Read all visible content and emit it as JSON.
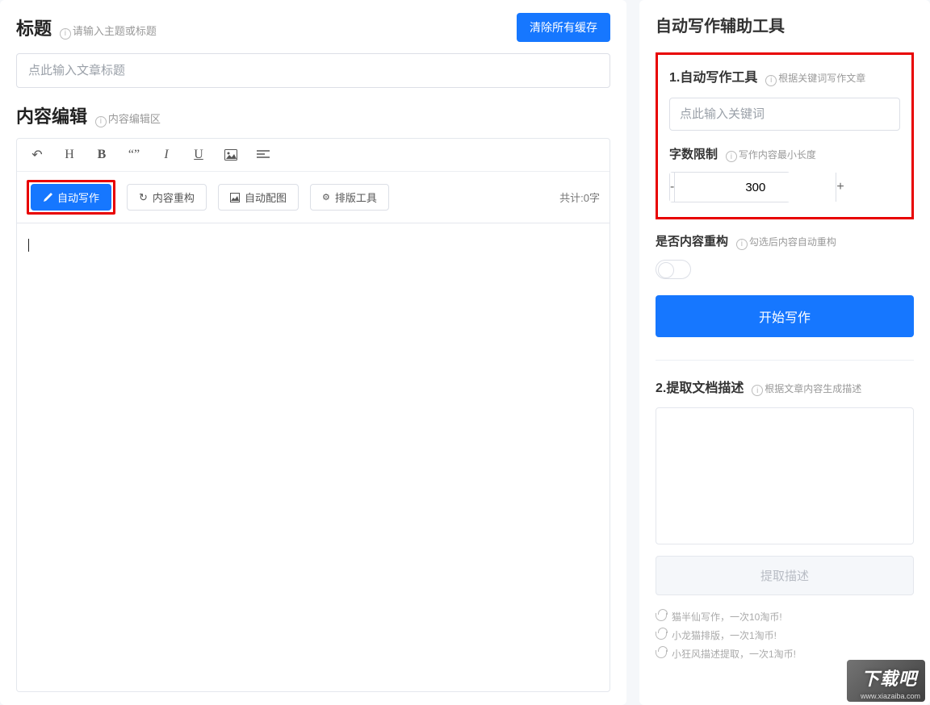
{
  "left": {
    "title_label": "标题",
    "title_hint": "请输入主题或标题",
    "clear_cache": "清除所有缓存",
    "title_placeholder": "点此输入文章标题",
    "content_label": "内容编辑",
    "content_hint": "内容编辑区",
    "toolbar_buttons": {
      "auto_write": "自动写作",
      "restructure": "内容重构",
      "auto_image": "自动配图",
      "layout_tool": "排版工具"
    },
    "count_text": "共计:0字"
  },
  "right": {
    "panel_title": "自动写作辅助工具",
    "sec1": {
      "head": "1.自动写作工具",
      "hint": "根据关键词写作文章",
      "keyword_placeholder": "点此输入关键词",
      "limit_label": "字数限制",
      "limit_hint": "写作内容最小长度",
      "limit_value": "300"
    },
    "restructure_label": "是否内容重构",
    "restructure_hint": "勾选后内容自动重构",
    "start_btn": "开始写作",
    "sec2": {
      "head": "2.提取文档描述",
      "hint": "根据文章内容生成描述",
      "extract_btn": "提取描述"
    },
    "costs": [
      "猫半仙写作，一次10淘币!",
      "小龙猫排版，一次1淘币!",
      "小狂风描述提取，一次1淘币!"
    ]
  },
  "watermark": {
    "main": "下载吧",
    "sub": "www.xiazaiba.com"
  }
}
